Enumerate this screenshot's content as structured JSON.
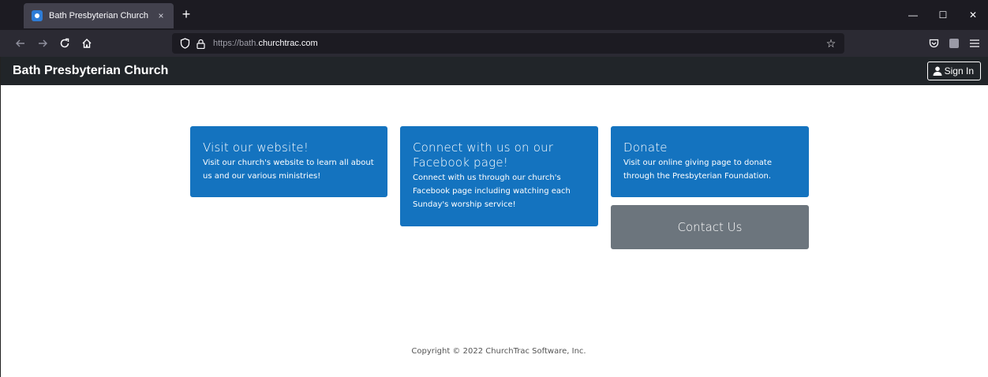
{
  "browser": {
    "tab_title": "Bath Presbyterian Church",
    "tab_close": "×",
    "new_tab": "+",
    "url_prefix": "https://bath.",
    "url_host": "churchtrac.com",
    "window_controls": {
      "minimize": "—",
      "maximize": "☐",
      "close": "✕"
    }
  },
  "site": {
    "brand": "Bath Presbyterian Church",
    "signin_label": "Sign In"
  },
  "cards": {
    "website": {
      "title": "Visit our website!",
      "text": "Visit our church's website to learn all about us and our various ministries!"
    },
    "facebook": {
      "title": "Connect with us on our Facebook page!",
      "text": "Connect with us through our church's Facebook page including watching each Sunday's worship service!"
    },
    "donate": {
      "title": "Donate",
      "text": "Visit our online giving page to donate through the Presbyterian Foundation."
    },
    "contact": {
      "label": "Contact Us"
    }
  },
  "footer": {
    "copyright": "Copyright © 2022 ChurchTrac Software, Inc."
  },
  "colors": {
    "card_blue": "#1473bf",
    "card_gray": "#6c757d",
    "header_bg": "#212529"
  }
}
